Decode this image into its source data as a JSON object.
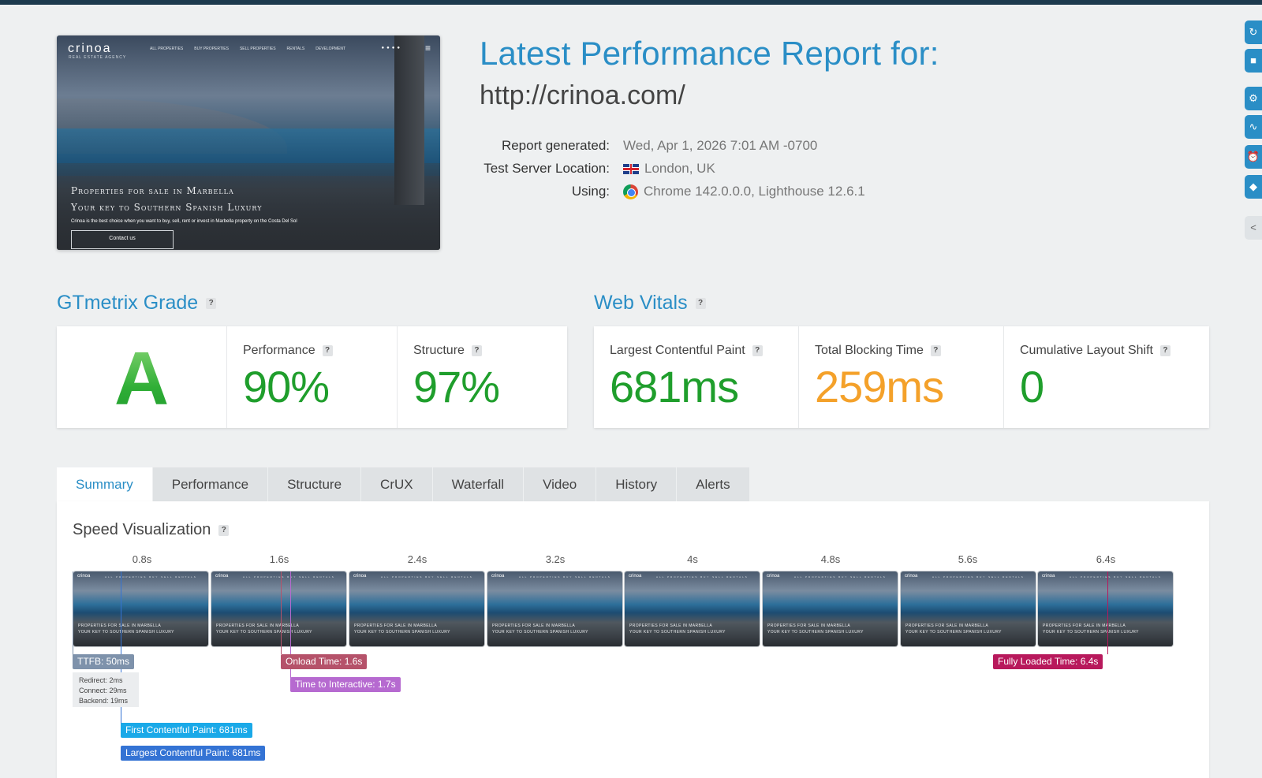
{
  "header": {
    "title": "Latest Performance Report for:",
    "url": "http://crinoa.com/",
    "meta": [
      {
        "key": "Report generated:",
        "value": "Wed, Apr 1, 2026 7:01 AM -0700",
        "icon": ""
      },
      {
        "key": "Test Server Location:",
        "value": "London, UK",
        "icon": "uk-flag-icon"
      },
      {
        "key": "Using:",
        "value": "Chrome 142.0.0.0, Lighthouse 12.6.1",
        "icon": "chrome-icon"
      }
    ]
  },
  "screenshot": {
    "logo": "crinoa",
    "logo_sub": "REAL ESTATE AGENCY",
    "nav": [
      "ALL PROPERTIES",
      "BUY PROPERTIES",
      "SELL PROPERTIES",
      "RENTALS",
      "DEVELOPMENT"
    ],
    "headline1": "Properties for sale in Marbella",
    "headline2": "Your key to Southern Spanish Luxury",
    "description": "Crinoa is the best choice when you want to buy, sell, rent or invest in Marbella property on the Costa Del Sol",
    "cta": "Contact us"
  },
  "grade": {
    "heading": "GTmetrix Grade",
    "help": "?",
    "letter": "A",
    "performance_label": "Performance",
    "performance_value": "90%",
    "structure_label": "Structure",
    "structure_value": "97%"
  },
  "vitals": {
    "heading": "Web Vitals",
    "help": "?",
    "lcp_label": "Largest Contentful Paint",
    "lcp_value": "681ms",
    "tbt_label": "Total Blocking Time",
    "tbt_value": "259ms",
    "cls_label": "Cumulative Layout Shift",
    "cls_value": "0"
  },
  "tabs": [
    "Summary",
    "Performance",
    "Structure",
    "CrUX",
    "Waterfall",
    "Video",
    "History",
    "Alerts"
  ],
  "active_tab": "Summary",
  "speed": {
    "title": "Speed Visualization",
    "help": "?",
    "ticks": [
      "0.8s",
      "1.6s",
      "2.4s",
      "3.2s",
      "4s",
      "4.8s",
      "5.6s",
      "6.4s"
    ],
    "frame_text_1": "PROPERTIES FOR SALE IN MARBELLA",
    "frame_text_2": "YOUR KEY TO SOUTHERN SPANISH LUXURY",
    "frame_logo": "crinoa",
    "frame_nav": "ALL PROPERTIES  BUY  SELL  RENTALS",
    "markers": {
      "ttfb": "TTFB: 50ms",
      "redirect": "Redirect: 2ms",
      "connect": "Connect: 29ms",
      "backend": "Backend: 19ms",
      "onload": "Onload Time: 1.6s",
      "tti": "Time to Interactive: 1.7s",
      "fully_loaded": "Fully Loaded Time: 6.4s",
      "fcp": "First Contentful Paint: 681ms",
      "lcp": "Largest Contentful Paint: 681ms"
    }
  },
  "colors": {
    "accent": "#2a8ec6",
    "good": "#1f9e2c",
    "warn": "#f4a12a",
    "ttfb": "#7e92ab",
    "onload": "#b5526a",
    "tti": "#b66ad0",
    "fully_loaded": "#b8195c",
    "fcp": "#1aa9e8",
    "lcp": "#3473d4"
  },
  "rail_icons": [
    "refresh-icon",
    "document-icon",
    "gear-icon",
    "pulse-icon",
    "alarm-icon",
    "tag-icon",
    "share-icon"
  ]
}
